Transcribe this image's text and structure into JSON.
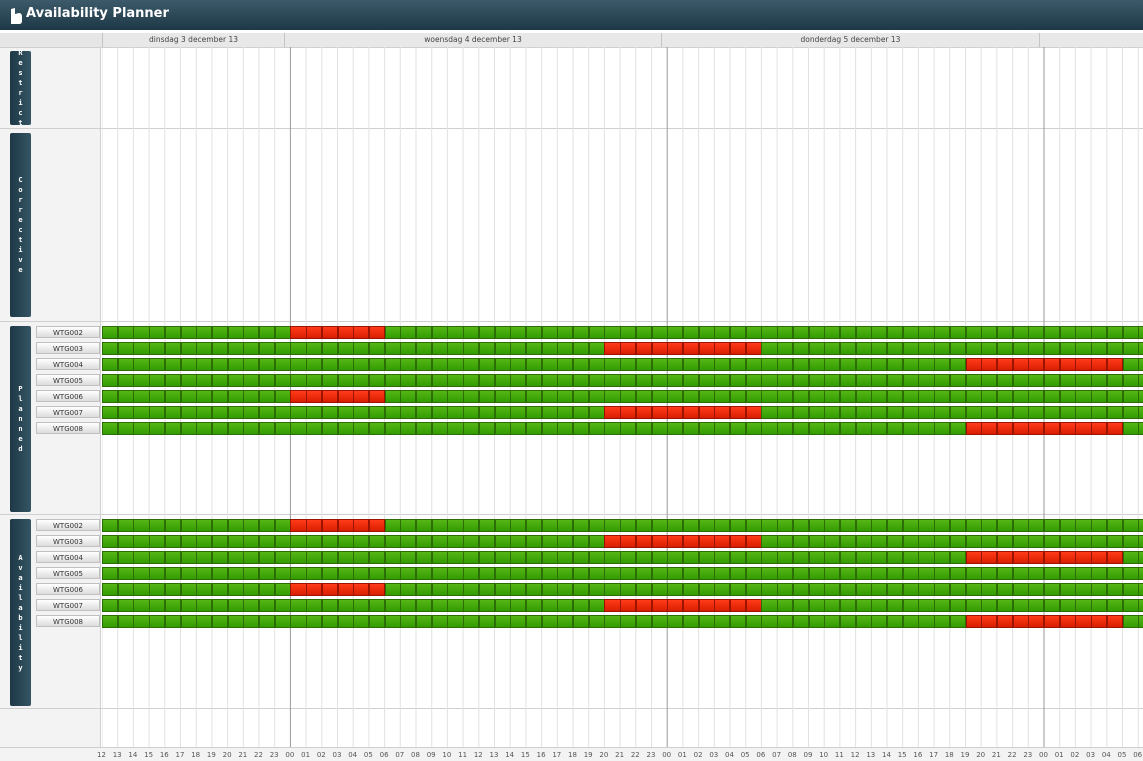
{
  "app": {
    "title": "Availability Planner",
    "icon": "planner-logo-icon"
  },
  "colors": {
    "title_bar": "#2a4654",
    "available": "#3ca10a",
    "unavailable": "#f02e0e",
    "section_tab": "#1e3846"
  },
  "days": [
    {
      "label": "dinsdag 3 december 13"
    },
    {
      "label": "woensdag 4 december 13"
    },
    {
      "label": "donderdag 5 december 13"
    },
    {
      "label": ""
    }
  ],
  "hours": [
    "12",
    "13",
    "14",
    "15",
    "16",
    "17",
    "18",
    "19",
    "20",
    "21",
    "22",
    "23",
    "00",
    "01",
    "02",
    "03",
    "04",
    "05",
    "06",
    "07",
    "08",
    "09",
    "10",
    "11",
    "12",
    "13",
    "14",
    "15",
    "16",
    "17",
    "18",
    "19",
    "20",
    "21",
    "22",
    "23",
    "00",
    "01",
    "02",
    "03",
    "04",
    "05",
    "06",
    "07",
    "08",
    "09",
    "10",
    "11",
    "12",
    "13",
    "14",
    "15",
    "16",
    "17",
    "18",
    "19",
    "20",
    "21",
    "22",
    "23",
    "00",
    "01",
    "02",
    "03",
    "04",
    "05",
    "06"
  ],
  "sections": [
    {
      "key": "restrict",
      "label": "Restrict",
      "rows": []
    },
    {
      "key": "corrective",
      "label": "Corrective",
      "rows": []
    },
    {
      "key": "planned",
      "label": "Planned",
      "rows": [
        {
          "name": "WTG002",
          "unavailable": [
            [
              12,
              18
            ]
          ]
        },
        {
          "name": "WTG003",
          "unavailable": [
            [
              32,
              42
            ]
          ]
        },
        {
          "name": "WTG004",
          "unavailable": [
            [
              55,
              65
            ]
          ]
        },
        {
          "name": "WTG005",
          "unavailable": []
        },
        {
          "name": "WTG006",
          "unavailable": [
            [
              12,
              18
            ]
          ]
        },
        {
          "name": "WTG007",
          "unavailable": [
            [
              32,
              42
            ]
          ]
        },
        {
          "name": "WTG008",
          "unavailable": [
            [
              55,
              65
            ]
          ]
        }
      ]
    },
    {
      "key": "availability",
      "label": "Availability",
      "rows": [
        {
          "name": "WTG002",
          "unavailable": [
            [
              12,
              18
            ]
          ]
        },
        {
          "name": "WTG003",
          "unavailable": [
            [
              32,
              42
            ]
          ]
        },
        {
          "name": "WTG004",
          "unavailable": [
            [
              55,
              65
            ]
          ]
        },
        {
          "name": "WTG005",
          "unavailable": []
        },
        {
          "name": "WTG006",
          "unavailable": [
            [
              12,
              18
            ]
          ]
        },
        {
          "name": "WTG007",
          "unavailable": [
            [
              32,
              42
            ]
          ]
        },
        {
          "name": "WTG008",
          "unavailable": [
            [
              55,
              65
            ]
          ]
        }
      ]
    }
  ]
}
